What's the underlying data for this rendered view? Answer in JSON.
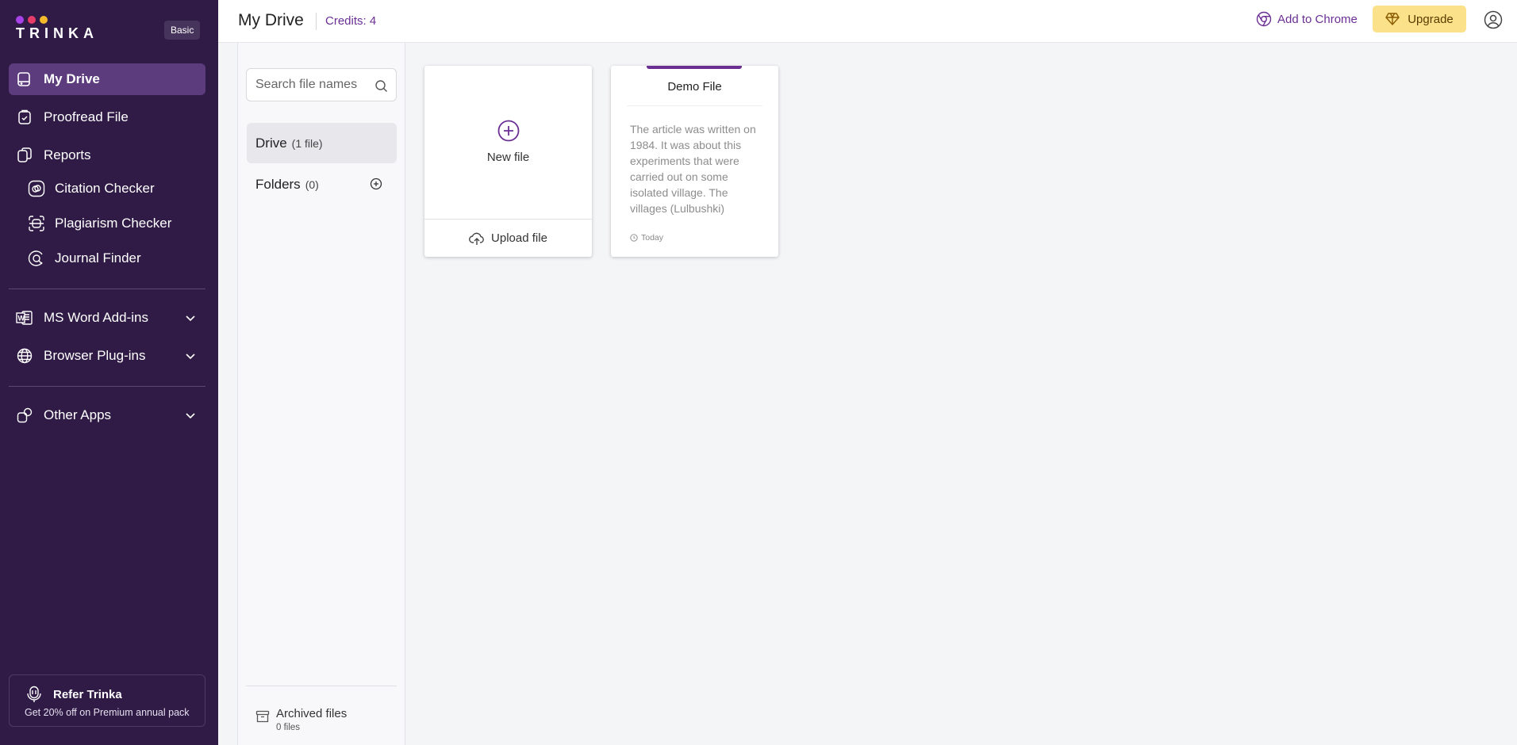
{
  "brand": {
    "logo_text": "TRINKA",
    "logo_dot_colors": [
      "#a742e8",
      "#e83c6a",
      "#f5b92c"
    ],
    "plan_badge": "Basic",
    "sidebar_bg": "#2f1b45",
    "accent": "#6b2f94"
  },
  "sidebar": {
    "items": [
      {
        "label": "My Drive",
        "icon": "drive-icon",
        "active": true
      },
      {
        "label": "Proofread File",
        "icon": "proofread-icon"
      },
      {
        "label": "Reports",
        "icon": "reports-icon"
      },
      {
        "label": "Citation Checker",
        "icon": "citation-icon"
      },
      {
        "label": "Plagiarism Checker",
        "icon": "plagiarism-icon"
      },
      {
        "label": "Journal Finder",
        "icon": "journal-finder-icon"
      },
      {
        "label": "MS Word Add-ins",
        "icon": "word-icon"
      },
      {
        "label": "Browser Plug-ins",
        "icon": "globe-icon"
      },
      {
        "label": "Other Apps",
        "icon": "apps-icon"
      }
    ],
    "refer": {
      "title": "Refer Trinka",
      "subtitle": "Get 20% off on Premium annual pack"
    }
  },
  "header": {
    "title": "My Drive",
    "credits": "Credits: 4",
    "add_to_chrome": "Add to Chrome",
    "upgrade": "Upgrade"
  },
  "panel": {
    "search_placeholder": "Search file names",
    "drive": {
      "name": "Drive",
      "count": "(1 file)"
    },
    "folders": {
      "name": "Folders",
      "count": "(0)"
    },
    "archived": {
      "title": "Archived files",
      "count": "0 files"
    }
  },
  "cards": {
    "new_file": "New file",
    "upload_file": "Upload file",
    "demo": {
      "name": "Demo File",
      "preview": "The article was written on 1984. It was about this experiments that were carried out on some isolated village. The villages (Lulbushki)",
      "date": "Today"
    }
  }
}
